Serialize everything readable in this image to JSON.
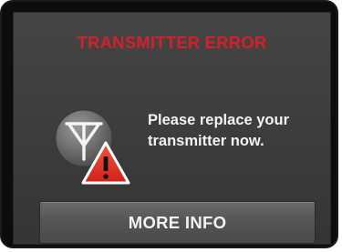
{
  "error": {
    "title": "TRANSMITTER ERROR",
    "message": "Please replace your transmitter now.",
    "title_color": "#d3202b",
    "icons": [
      "transmitter-icon",
      "warning-icon"
    ]
  },
  "actions": {
    "more_info_label": "MORE INFO"
  }
}
